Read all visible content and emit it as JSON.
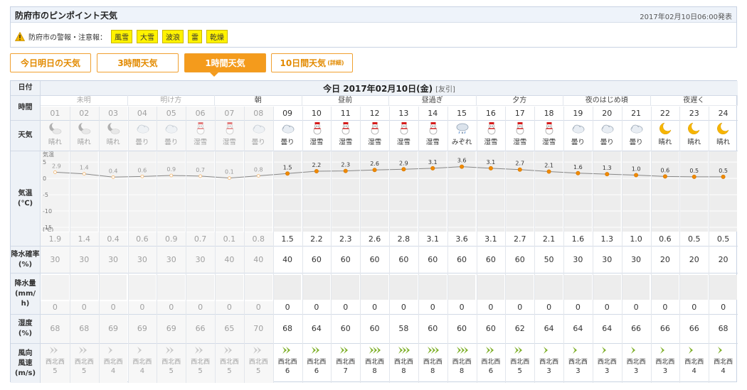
{
  "header": {
    "title": "防府市のピンポイント天気",
    "issued": "2017年02月10日06:00発表",
    "warning_label": "防府市の警報・注意報：",
    "warnings": [
      "風雪",
      "大雪",
      "波浪",
      "雷",
      "乾燥"
    ],
    "warning_icon": "warning-triangle-icon"
  },
  "tabs": [
    {
      "label": "今日明日の天気",
      "small": ""
    },
    {
      "label": "3時間天気",
      "small": ""
    },
    {
      "label": "1時間天気",
      "small": ""
    },
    {
      "label": "10日間天気",
      "small": "(詳細)"
    }
  ],
  "active_tab": "1時間天気",
  "table": {
    "row_labels": {
      "date": "日付",
      "time": "時間",
      "weather": "天気",
      "temp": "気温\n(℃)",
      "precip_prob": "降水確率\n(%)",
      "precip_amount": "降水量\n(mm/\nh)",
      "humidity": "湿度\n(%)",
      "wind": "風向\n風速\n(m/s)"
    },
    "date_label": "今日 2017年02月10日(金)",
    "rokuyo": "[友引]",
    "periods": [
      {
        "label": "未明",
        "span": 3,
        "past": true
      },
      {
        "label": "明け方",
        "span": 3,
        "past": true
      },
      {
        "label": "朝",
        "span": 3,
        "past": false
      },
      {
        "label": "昼前",
        "span": 3,
        "past": false
      },
      {
        "label": "昼過ぎ",
        "span": 3,
        "past": false
      },
      {
        "label": "夕方",
        "span": 3,
        "past": false
      },
      {
        "label": "夜のはじめ頃",
        "span": 3,
        "past": false
      },
      {
        "label": "夜遅く",
        "span": 3,
        "past": false
      }
    ],
    "hours": [
      "01",
      "02",
      "03",
      "04",
      "05",
      "06",
      "07",
      "08",
      "09",
      "10",
      "11",
      "12",
      "13",
      "14",
      "15",
      "16",
      "17",
      "18",
      "19",
      "20",
      "21",
      "22",
      "23",
      "24"
    ],
    "past_hours": 8,
    "weather": [
      {
        "label": "晴れ",
        "icon": "moon-cloud-icon"
      },
      {
        "label": "晴れ",
        "icon": "moon-cloud-icon"
      },
      {
        "label": "晴れ",
        "icon": "moon-cloud-icon"
      },
      {
        "label": "曇り",
        "icon": "cloud-icon"
      },
      {
        "label": "曇り",
        "icon": "cloud-icon"
      },
      {
        "label": "湿雪",
        "icon": "snowman-icon"
      },
      {
        "label": "湿雪",
        "icon": "snowman-icon"
      },
      {
        "label": "曇り",
        "icon": "cloud-icon"
      },
      {
        "label": "曇り",
        "icon": "cloud-icon"
      },
      {
        "label": "湿雪",
        "icon": "snowman-icon"
      },
      {
        "label": "湿雪",
        "icon": "snowman-icon"
      },
      {
        "label": "湿雪",
        "icon": "snowman-icon"
      },
      {
        "label": "湿雪",
        "icon": "snowman-icon"
      },
      {
        "label": "湿雪",
        "icon": "snowman-icon"
      },
      {
        "label": "みぞれ",
        "icon": "sleet-icon"
      },
      {
        "label": "湿雪",
        "icon": "snowman-icon"
      },
      {
        "label": "湿雪",
        "icon": "snowman-icon"
      },
      {
        "label": "湿雪",
        "icon": "snowman-icon"
      },
      {
        "label": "曇り",
        "icon": "cloud-icon"
      },
      {
        "label": "曇り",
        "icon": "cloud-icon"
      },
      {
        "label": "曇り",
        "icon": "cloud-icon"
      },
      {
        "label": "晴れ",
        "icon": "crescent-moon-icon"
      },
      {
        "label": "晴れ",
        "icon": "crescent-moon-icon"
      },
      {
        "label": "晴れ",
        "icon": "crescent-moon-icon"
      }
    ],
    "temperature": [
      "1.9",
      "1.4",
      "0.4",
      "0.6",
      "0.9",
      "0.7",
      "0.1",
      "0.8",
      "1.5",
      "2.2",
      "2.3",
      "2.6",
      "2.8",
      "3.1",
      "3.6",
      "3.1",
      "2.7",
      "2.1",
      "1.6",
      "1.3",
      "1.0",
      "0.6",
      "0.5",
      "0.5"
    ],
    "temp_chart_labels": [
      "2.9",
      "1.4",
      "0.4",
      "0.6",
      "0.9",
      "0.7",
      "0.1",
      "0.8",
      "1.5",
      "2.2",
      "2.3",
      "2.6",
      "2.9",
      "3.1",
      "3.6",
      "3.1",
      "2.7",
      "2.1",
      "1.6",
      "1.3",
      "1.0",
      "0.6",
      "0.5",
      "0.5"
    ],
    "precip_prob": [
      "30",
      "30",
      "30",
      "30",
      "30",
      "30",
      "40",
      "40",
      "40",
      "60",
      "60",
      "60",
      "60",
      "60",
      "60",
      "60",
      "60",
      "50",
      "30",
      "30",
      "30",
      "20",
      "20",
      "20"
    ],
    "precip_amount": [
      "0",
      "0",
      "0",
      "0",
      "0",
      "0",
      "0",
      "0",
      "0",
      "0",
      "0",
      "0",
      "0",
      "0",
      "0",
      "0",
      "0",
      "0",
      "0",
      "0",
      "0",
      "0",
      "0",
      "0"
    ],
    "humidity": [
      "68",
      "68",
      "69",
      "69",
      "69",
      "66",
      "65",
      "70",
      "68",
      "64",
      "60",
      "60",
      "58",
      "60",
      "60",
      "60",
      "62",
      "64",
      "64",
      "64",
      "66",
      "66",
      "66",
      "68"
    ],
    "wind_dir": [
      "西北西",
      "西北西",
      "西北西",
      "西北西",
      "西北西",
      "西北西",
      "西北西",
      "西北西",
      "西北西",
      "西北西",
      "西北西",
      "西北西",
      "西北西",
      "西北西",
      "西北西",
      "西北西",
      "西北西",
      "西北西",
      "西北西",
      "西北西",
      "西北西",
      "西北西",
      "西北西",
      "西北西"
    ],
    "wind_speed": [
      "5",
      "5",
      "4",
      "4",
      "5",
      "5",
      "5",
      "5",
      "6",
      "6",
      "7",
      "8",
      "8",
      "8",
      "8",
      "6",
      "5",
      "3",
      "3",
      "3",
      "3",
      "3",
      "4",
      "4"
    ]
  },
  "chart_data": {
    "type": "line",
    "title": "",
    "xlabel": "",
    "ylabel": "気温 (℃)",
    "y_tick_labels": [
      "気温",
      "5",
      "0",
      "-5",
      "-10",
      "-15",
      "(℃)"
    ],
    "ylim": [
      -15,
      7
    ],
    "x": [
      "01",
      "02",
      "03",
      "04",
      "05",
      "06",
      "07",
      "08",
      "09",
      "10",
      "11",
      "12",
      "13",
      "14",
      "15",
      "16",
      "17",
      "18",
      "19",
      "20",
      "21",
      "22",
      "23",
      "24"
    ],
    "series": [
      {
        "values": [
          1.9,
          1.4,
          0.4,
          0.6,
          0.9,
          0.7,
          0.1,
          0.8,
          1.5,
          2.2,
          2.3,
          2.6,
          2.8,
          3.1,
          3.6,
          3.1,
          2.7,
          2.1,
          1.6,
          1.3,
          1.0,
          0.6,
          0.5,
          0.5
        ]
      }
    ],
    "colors": {
      "line": "#888888",
      "marker": "#f08a00"
    }
  }
}
